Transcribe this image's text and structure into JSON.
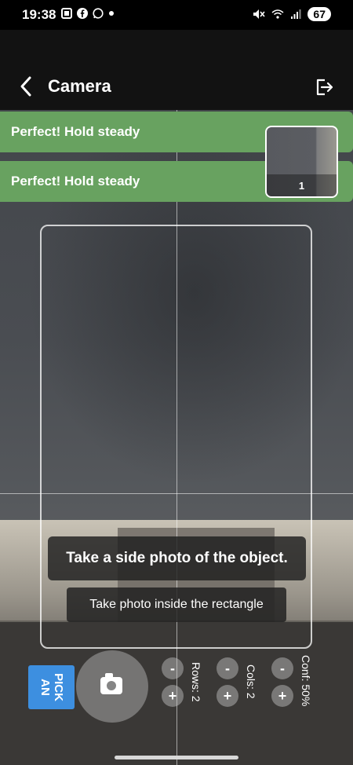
{
  "status_bar": {
    "time": "19:38",
    "left_icons": [
      "screenshot-icon",
      "facebook-icon",
      "whatsapp-icon",
      "dot-icon"
    ],
    "right_icons": [
      "mute-icon",
      "wifi-icon",
      "signal-icon"
    ],
    "battery": "67"
  },
  "header": {
    "title": "Camera",
    "back_icon": "chevron-left-icon",
    "exit_icon": "logout-icon"
  },
  "banners": [
    "Perfect! Hold steady",
    "Perfect! Hold steady"
  ],
  "thumbnail": {
    "count": "1"
  },
  "hints": {
    "main": "Take a side photo of the object.",
    "sub": "Take photo inside the rectangle"
  },
  "controls": {
    "pick_button": "PICK\nAN",
    "rows_label": "Rows: 2",
    "cols_label": "Cols: 2",
    "conf_label": "Conf: 50%",
    "minus": "-",
    "plus": "+"
  }
}
